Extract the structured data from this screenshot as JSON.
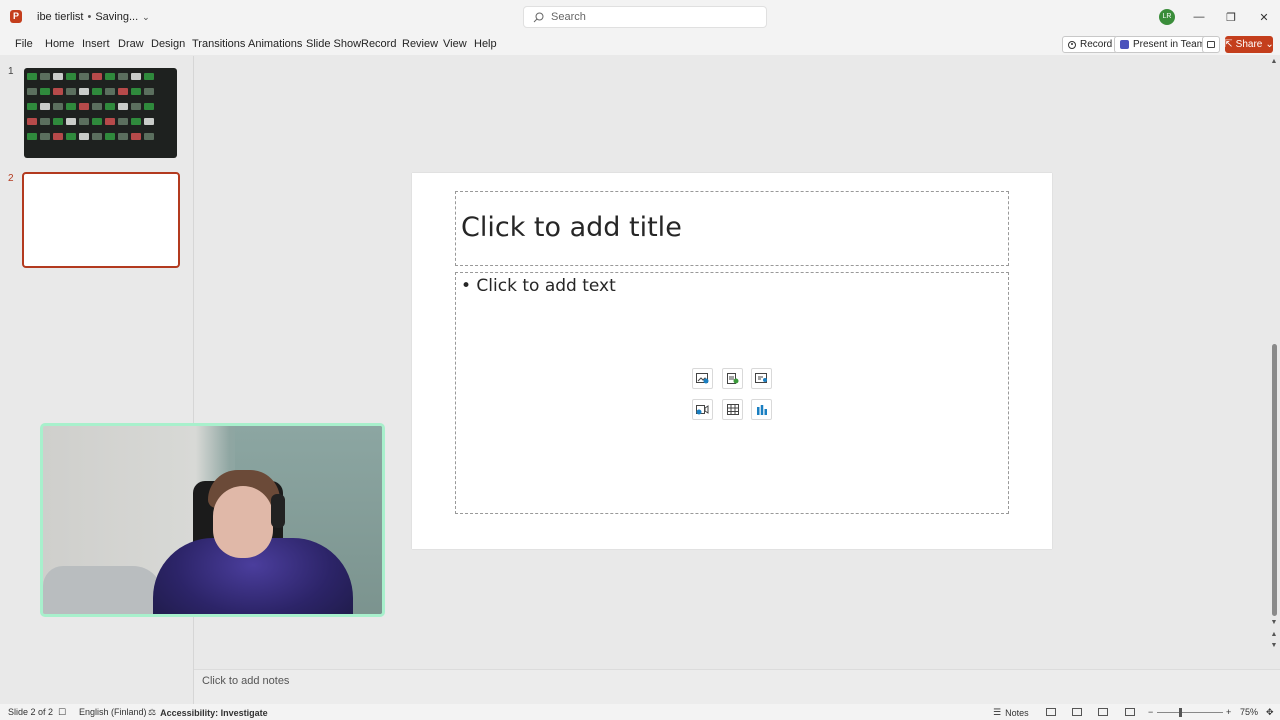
{
  "titlebar": {
    "app_logo_letter": "P",
    "doc_name": "ibe tierlist",
    "separator": "•",
    "save_status": "Saving...",
    "search_placeholder": "Search",
    "user_initials": "LR",
    "window_buttons": {
      "minimize": "—",
      "restore": "❐",
      "close": "✕"
    }
  },
  "ribbon": {
    "tabs": [
      "File",
      "Home",
      "Insert",
      "Draw",
      "Design",
      "Transitions",
      "Animations",
      "Slide Show",
      "Record",
      "Review",
      "View",
      "Help"
    ],
    "record_label": "Record",
    "teams_label": "Present in Teams",
    "share_label": "Share",
    "share_chevron": "⌄"
  },
  "thumbnails": {
    "numbers": [
      "1",
      "2"
    ],
    "current_index": 2
  },
  "slide": {
    "title_placeholder": "Click to add title",
    "body_placeholder": "• Click to add text",
    "insert_icons": [
      "insert-picture-icon",
      "insert-stock-images-icon",
      "insert-icons-icon",
      "insert-video-icon",
      "insert-table-icon",
      "insert-chart-icon"
    ]
  },
  "notes": {
    "placeholder": "Click to add notes"
  },
  "statusbar": {
    "slide_counter": "Slide 2 of 2",
    "language": "English (Finland)",
    "accessibility": "Accessibility: Investigate",
    "notes_label": "Notes",
    "zoom_percent": "75%",
    "zoom_minus": "−",
    "zoom_plus": "+"
  },
  "colors": {
    "brand": "#c43e1c",
    "selection": "#b33a1f",
    "webcam_border": "#a8f0cc"
  }
}
